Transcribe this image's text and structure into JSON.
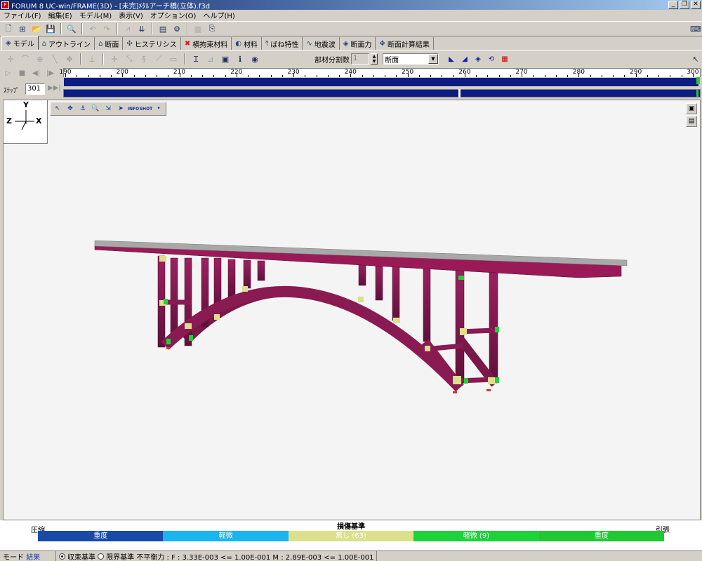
{
  "window": {
    "title": "FORUM 8  UC-win/FRAME(3D) - [未完]ﾒﾀﾙアーチ橋(立体).f3d",
    "controls": [
      "minimize-icon",
      "restore-icon",
      "close-icon"
    ]
  },
  "menu": [
    "ファイル(F)",
    "編集(E)",
    "モデル(M)",
    "表示(V)",
    "オプション(O)",
    "ヘルプ(H)"
  ],
  "tabs": [
    {
      "label": "モデル",
      "active": true
    },
    {
      "label": "アウトライン"
    },
    {
      "label": "断面"
    },
    {
      "label": "ヒステリシス"
    },
    {
      "label": "横拘束材料"
    },
    {
      "label": "材料"
    },
    {
      "label": "ばね特性"
    },
    {
      "label": "地震波"
    },
    {
      "label": "断面力"
    },
    {
      "label": "断面計算結果"
    }
  ],
  "member_divisions": {
    "label": "部材分割数",
    "value": "1"
  },
  "view_select": {
    "value": "断面"
  },
  "timeline": {
    "ticks": [
      "190",
      "200",
      "210",
      "220",
      "230",
      "240",
      "250",
      "260",
      "270",
      "280",
      "290",
      "300"
    ],
    "step_label": "ｽﾃｯﾌﾟ",
    "step_value": "301",
    "range": [
      190,
      301
    ],
    "current_step": 301,
    "lower_bar_split_fraction": 0.62
  },
  "viewport": {
    "axes": {
      "y": "Y",
      "z": "Z",
      "x": "X"
    }
  },
  "legend": {
    "title": "損傷基準",
    "left_label": "圧縮",
    "right_label": "引張",
    "segments": [
      {
        "label": "重度",
        "color": "#1a4aa8"
      },
      {
        "label": "軽微",
        "color": "#1ab4f0"
      },
      {
        "label": "無し (63)",
        "color": "#dce08c"
      },
      {
        "label": "軽微 (9)",
        "color": "#1ed23c"
      },
      {
        "label": "重度",
        "color": "#20c832"
      }
    ]
  },
  "status": {
    "mode_label": "モード",
    "mode_value": "結果",
    "radio1": "収束基準",
    "radio2": "限界基準",
    "imbalance": "不平衡力 : F : 3.33E-003 <= 1.00E-001  M : 2.89E-003 <= 1.00E-001"
  }
}
